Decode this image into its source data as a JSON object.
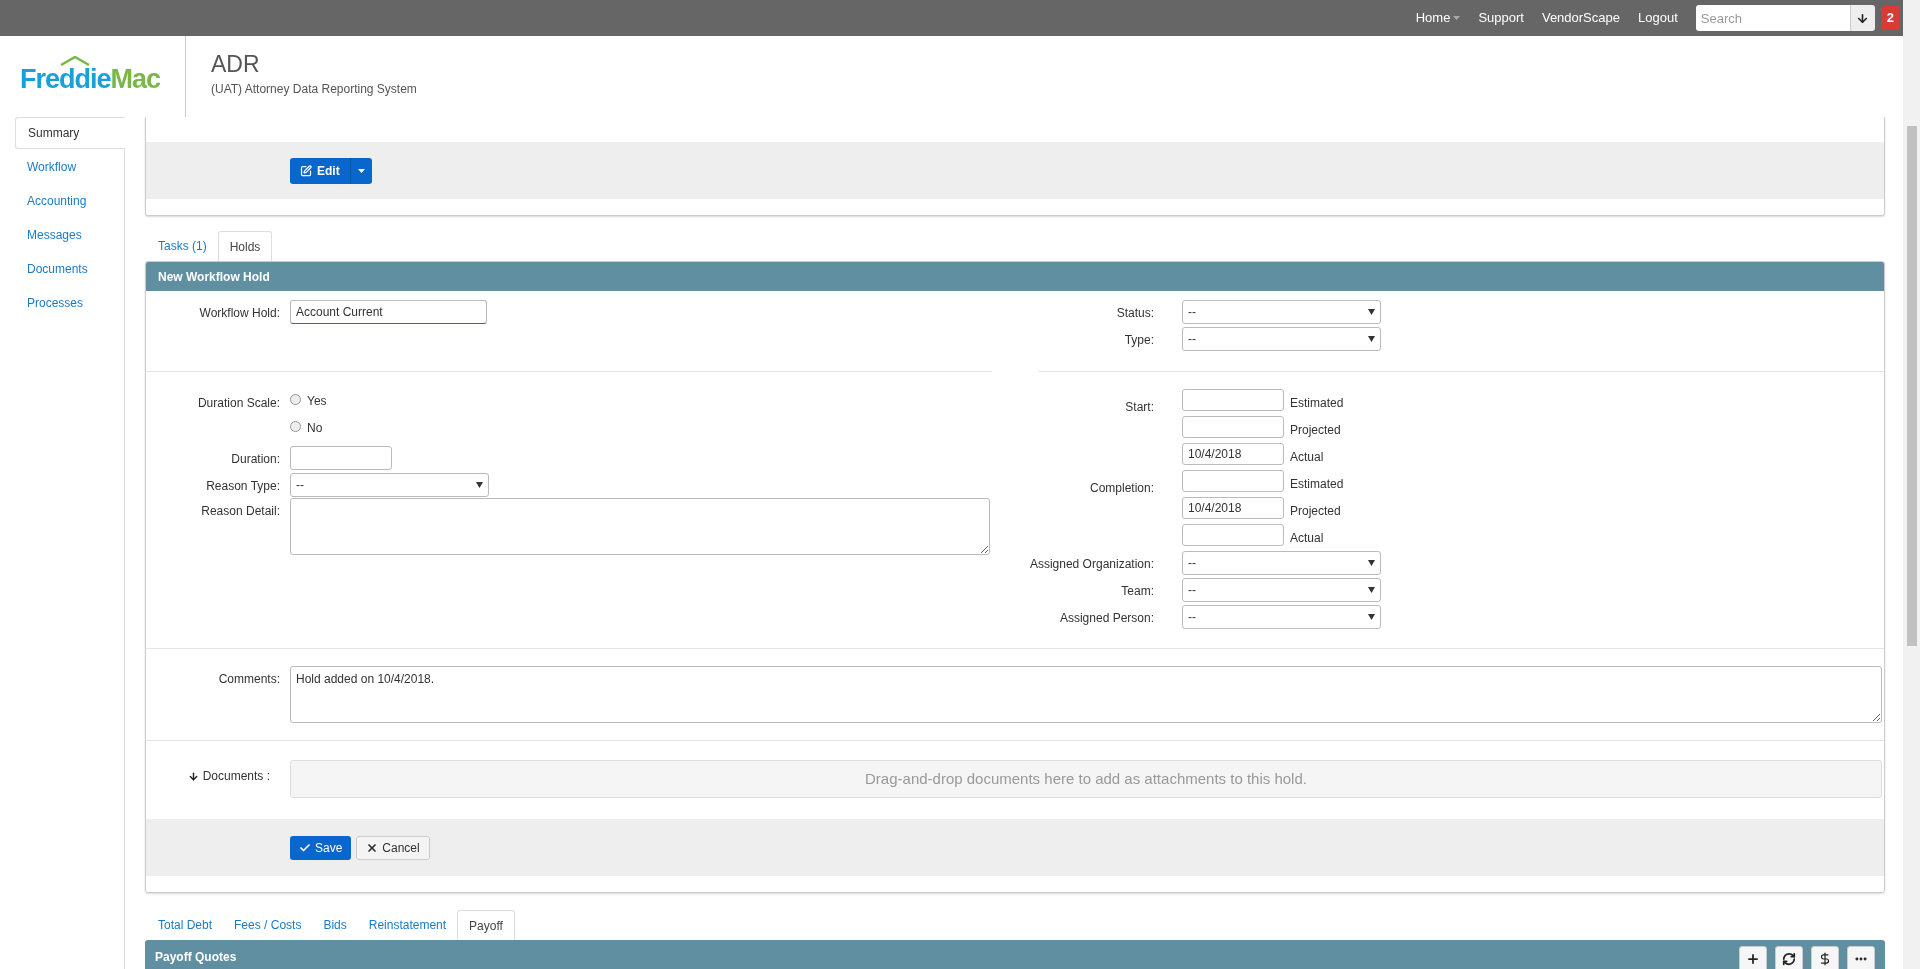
{
  "topbar": {
    "nav": [
      {
        "label": "Home",
        "caret": true
      },
      {
        "label": "Support",
        "caret": false
      },
      {
        "label": "VendorScape",
        "caret": false
      },
      {
        "label": "Logout",
        "caret": false
      }
    ],
    "search": {
      "placeholder": "Search"
    },
    "badge": "2"
  },
  "header": {
    "logo": {
      "first": "Freddie",
      "second": "Mac"
    },
    "title": "ADR",
    "subtitle": "(UAT) Attorney Data Reporting System"
  },
  "sidebar": {
    "items": [
      {
        "label": "Summary",
        "selected": true
      },
      {
        "label": "Workflow",
        "selected": false
      },
      {
        "label": "Accounting",
        "selected": false
      },
      {
        "label": "Messages",
        "selected": false
      },
      {
        "label": "Documents",
        "selected": false
      },
      {
        "label": "Processes",
        "selected": false
      }
    ]
  },
  "summary_card": {
    "edit_button": "Edit"
  },
  "tabs": [
    {
      "label": "Tasks (1)",
      "selected": false
    },
    {
      "label": "Holds",
      "selected": true
    }
  ],
  "hold_panel": {
    "title": "New Workflow Hold",
    "workflow_hold": {
      "label": "Workflow Hold:",
      "value": "Account Current",
      "invalid": true
    },
    "status": {
      "label": "Status:",
      "value": "--"
    },
    "type": {
      "label": "Type:",
      "value": "--"
    },
    "duration_scale": {
      "label": "Duration Scale:",
      "options": [
        {
          "label": "Yes",
          "selected": false
        },
        {
          "label": "No",
          "selected": false
        }
      ]
    },
    "duration": {
      "label": "Duration:"
    },
    "reason_type": {
      "label": "Reason Type:",
      "value": "--"
    },
    "reason_detail": {
      "label": "Reason Detail:"
    },
    "date_groups": [
      {
        "label": "Start:",
        "dates": [
          {
            "caption": "Estimated"
          },
          {
            "caption": "Projected"
          },
          {
            "value": "10/4/2018",
            "caption": "Actual"
          }
        ]
      },
      {
        "label": "Completion:",
        "dates": [
          {
            "caption": "Estimated"
          },
          {
            "value": "10/4/2018",
            "caption": "Projected"
          },
          {
            "caption": "Actual"
          }
        ]
      }
    ],
    "assign_selects": [
      {
        "label": "Assigned Organization:",
        "value": "--"
      },
      {
        "label": "Team:",
        "value": "--"
      },
      {
        "label": "Assigned Person:",
        "value": "--"
      }
    ],
    "comments": {
      "label": "Comments:",
      "value": "Hold added on 10/4/2018."
    },
    "documents": {
      "label": "Documents :",
      "drop_hint": "Drag-and-drop documents here to add as attachments to this hold."
    },
    "save_button": "Save",
    "cancel_button": "Cancel"
  },
  "lower_tabs": [
    {
      "label": "Total Debt",
      "selected": false
    },
    {
      "label": "Fees / Costs",
      "selected": false
    },
    {
      "label": "Bids",
      "selected": false
    },
    {
      "label": "Reinstatement",
      "selected": false
    },
    {
      "label": "Payoff",
      "selected": true
    }
  ],
  "payoff_panel": {
    "title": "Payoff Quotes",
    "tools": [
      {
        "kind": "add"
      },
      {
        "kind": "refresh"
      },
      {
        "kind": "dollar"
      },
      {
        "kind": "more"
      }
    ]
  }
}
